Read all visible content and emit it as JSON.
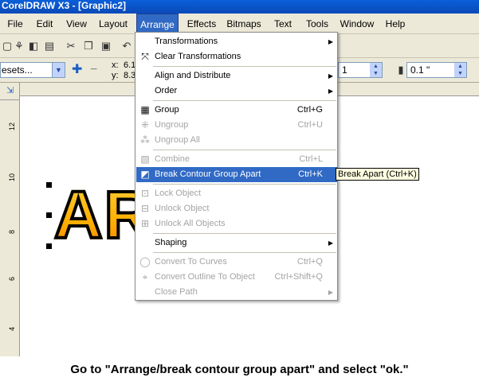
{
  "window": {
    "title": "CorelDRAW X3 - [Graphic2]"
  },
  "menubar": {
    "items": [
      "File",
      "Edit",
      "View",
      "Layout",
      "Arrange",
      "Effects",
      "Bitmaps",
      "Text",
      "Tools",
      "Window",
      "Help"
    ],
    "active": "Arrange"
  },
  "property_bar": {
    "presets": "esets...",
    "x_label": "x:",
    "x_value": "6.1",
    "y_label": "y:",
    "y_value": "8.3",
    "spin1": "1",
    "spin2": "0.1 \""
  },
  "ruler_left": [
    "12",
    "10",
    "8",
    "6",
    "4"
  ],
  "canvas": {
    "artwork_text": "ARROW"
  },
  "arrange_menu": {
    "items": [
      {
        "label": "Transformations",
        "shortcut": "",
        "submenu": true,
        "disabled": false,
        "icon": ""
      },
      {
        "label": "Clear Transformations",
        "shortcut": "",
        "submenu": false,
        "disabled": false,
        "icon": "clear-transform-icon"
      },
      {
        "label": "Align and Distribute",
        "shortcut": "",
        "submenu": true,
        "disabled": false,
        "icon": ""
      },
      {
        "label": "Order",
        "shortcut": "",
        "submenu": true,
        "disabled": false,
        "icon": ""
      },
      {
        "label": "Group",
        "shortcut": "Ctrl+G",
        "submenu": false,
        "disabled": false,
        "icon": "group-icon"
      },
      {
        "label": "Ungroup",
        "shortcut": "Ctrl+U",
        "submenu": false,
        "disabled": true,
        "icon": "ungroup-icon"
      },
      {
        "label": "Ungroup All",
        "shortcut": "",
        "submenu": false,
        "disabled": true,
        "icon": "ungroup-all-icon"
      },
      {
        "label": "Combine",
        "shortcut": "Ctrl+L",
        "submenu": false,
        "disabled": true,
        "icon": "combine-icon"
      },
      {
        "label": "Break Contour Group Apart",
        "shortcut": "Ctrl+K",
        "submenu": false,
        "disabled": false,
        "highlighted": true,
        "icon": "break-apart-icon"
      },
      {
        "label": "Lock Object",
        "shortcut": "",
        "submenu": false,
        "disabled": true,
        "icon": "lock-icon"
      },
      {
        "label": "Unlock Object",
        "shortcut": "",
        "submenu": false,
        "disabled": true,
        "icon": "unlock-icon"
      },
      {
        "label": "Unlock All Objects",
        "shortcut": "",
        "submenu": false,
        "disabled": true,
        "icon": "unlock-all-icon"
      },
      {
        "label": "Shaping",
        "shortcut": "",
        "submenu": true,
        "disabled": false,
        "icon": ""
      },
      {
        "label": "Convert To Curves",
        "shortcut": "Ctrl+Q",
        "submenu": false,
        "disabled": true,
        "icon": "curves-icon"
      },
      {
        "label": "Convert Outline To Object",
        "shortcut": "Ctrl+Shift+Q",
        "submenu": false,
        "disabled": true,
        "icon": "outline-icon"
      },
      {
        "label": "Close Path",
        "shortcut": "",
        "submenu": true,
        "disabled": true,
        "icon": ""
      }
    ]
  },
  "tooltip": "Break Apart (Ctrl+K)",
  "caption": "Go to \"Arrange/break contour group apart\" and select \"ok.\""
}
